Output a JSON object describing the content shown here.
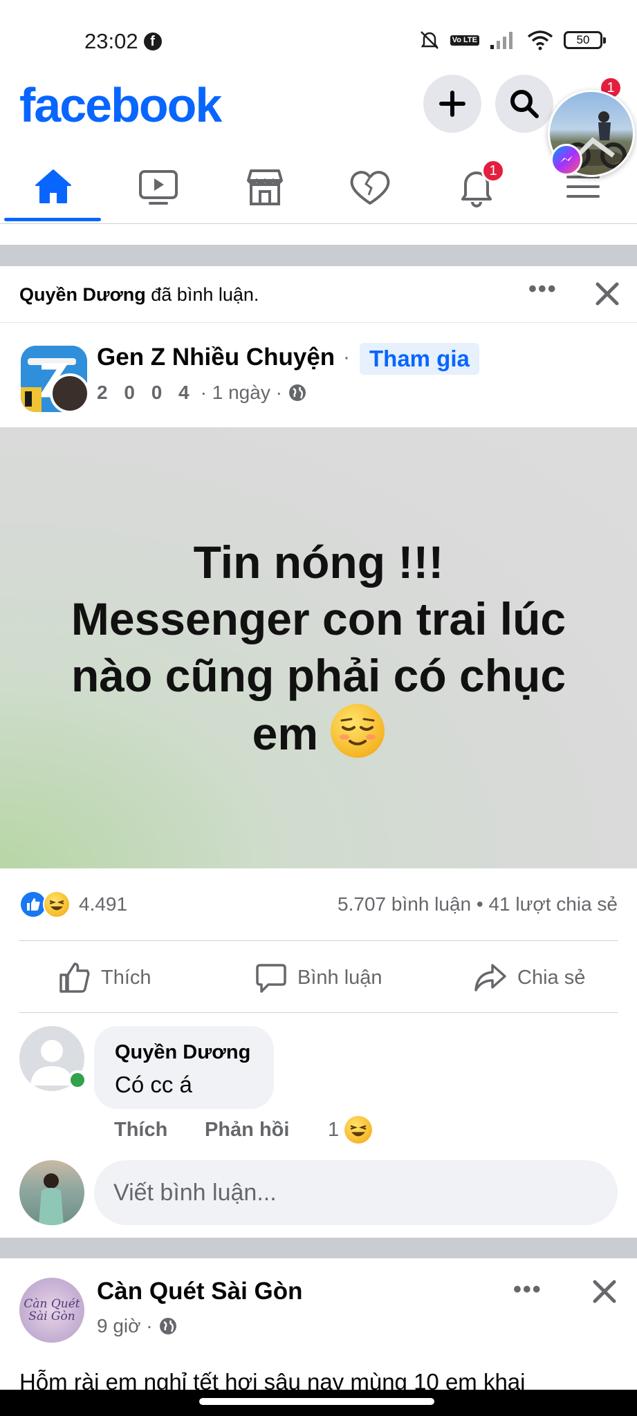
{
  "status_bar": {
    "time": "23:02",
    "volte": "Vo LTE",
    "battery": "50"
  },
  "header": {
    "logo": "facebook",
    "menu_badge": "1"
  },
  "tabs": [
    {
      "name": "home",
      "active": true
    },
    {
      "name": "video"
    },
    {
      "name": "marketplace"
    },
    {
      "name": "dating"
    },
    {
      "name": "notifications",
      "badge": "1"
    },
    {
      "name": "menu"
    }
  ],
  "notice": {
    "actor": "Quyền Dương",
    "action": " đã bình luận."
  },
  "post": {
    "group_name": "Gen Z Nhiều Chuyện",
    "separator": "·",
    "join_label": "Tham gia",
    "author": "2 0 0 4",
    "time": "· 1 ngày ·",
    "text_line1": "Tin nóng !!!",
    "text_line2": "Messenger con trai lúc",
    "text_line3": "nào cũng phải có chục",
    "text_line4": "em",
    "reaction_count": "4.491",
    "comments_shares": "5.707 bình luận • 41 lượt chia sẻ",
    "like_label": "Thích",
    "comment_label": "Bình luận",
    "share_label": "Chia sẻ"
  },
  "comment": {
    "name": "Quyền Dương",
    "text": "Có cc á",
    "like_label": "Thích",
    "reply_label": "Phản hồi",
    "reaction_count": "1"
  },
  "composer": {
    "placeholder": "Viết bình luận..."
  },
  "next_post": {
    "page_name": "Càn Quét Sài Gòn",
    "avatar_text": "Càn Quét Sài Gòn",
    "time": "9 giờ ·",
    "text": "Hỗm rài em nghỉ tết hơi sâu nay mùng 10 em khai"
  },
  "colors": {
    "brand": "#0866ff",
    "badge": "#e41e3f",
    "online": "#31a24c"
  }
}
